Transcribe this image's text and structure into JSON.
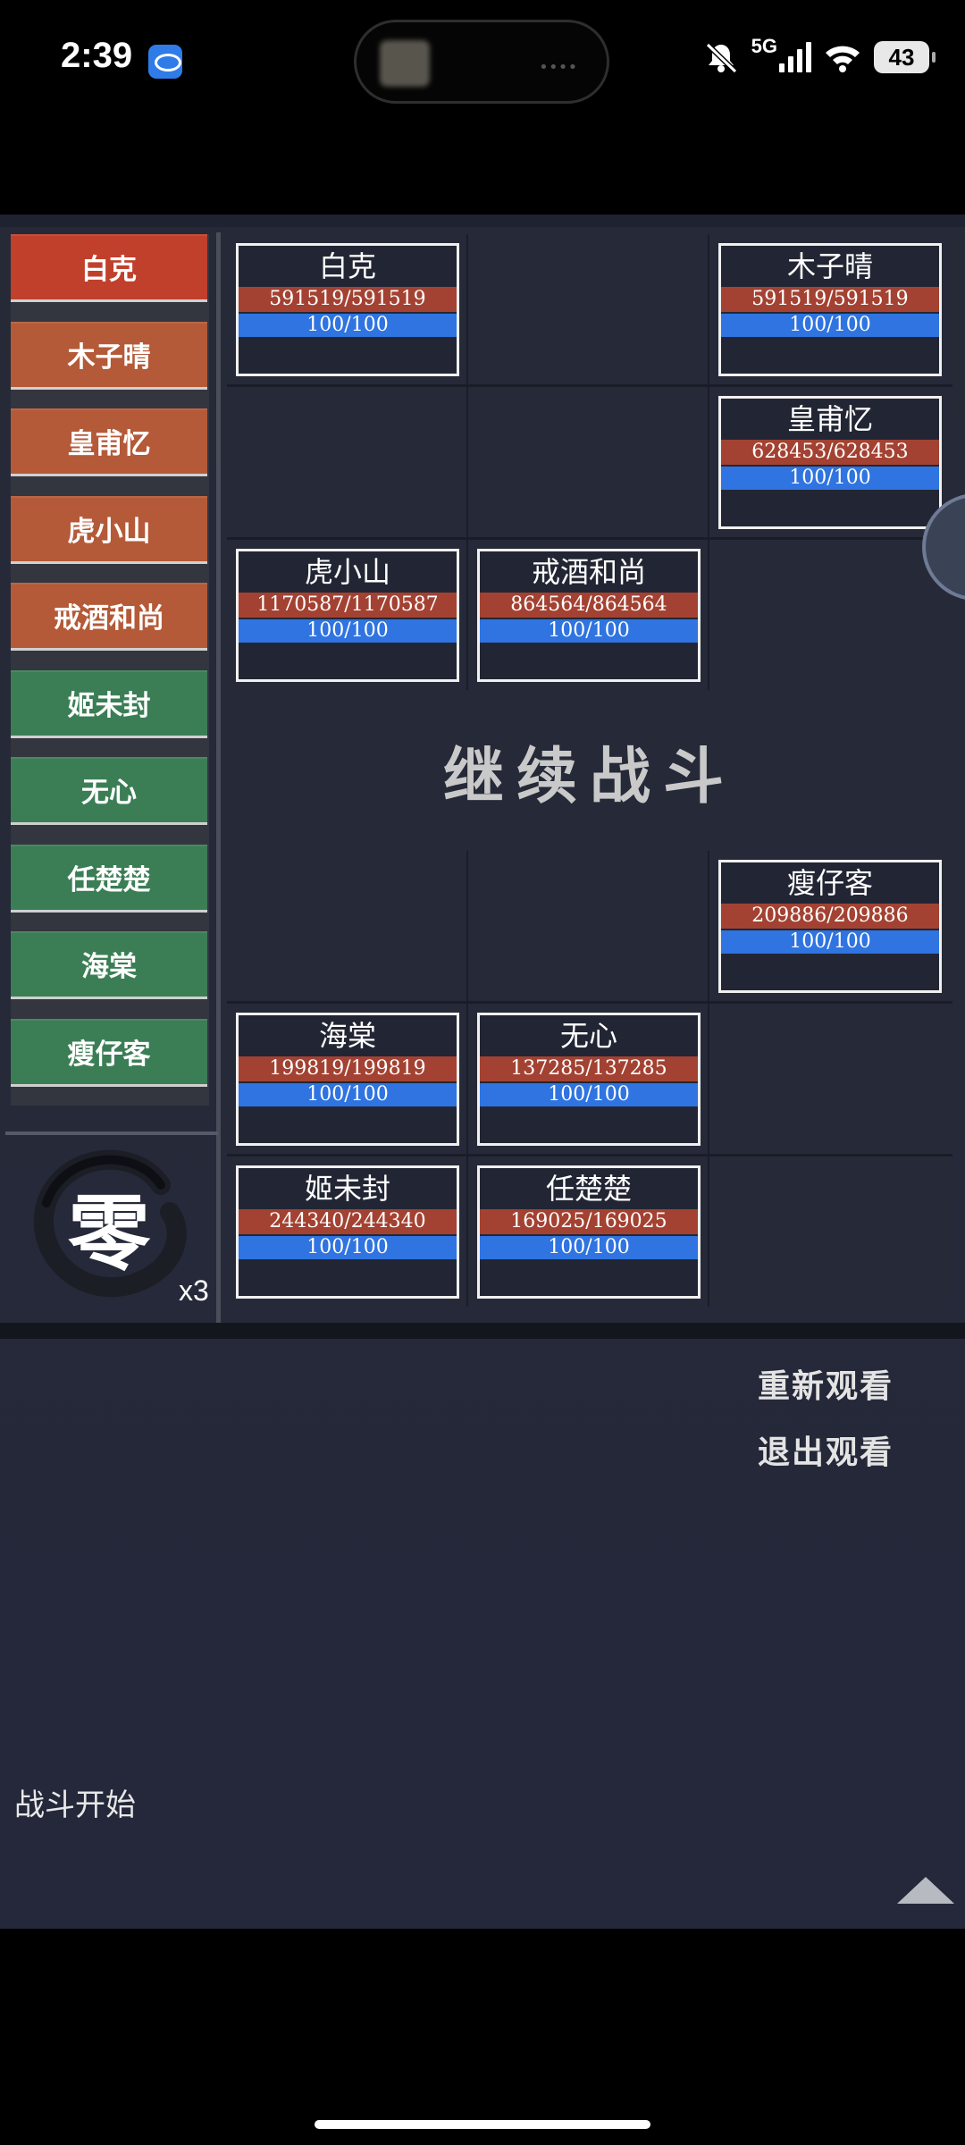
{
  "status_bar": {
    "time": "2:39",
    "network": "5G",
    "battery": "43"
  },
  "roster": [
    {
      "name": "白克",
      "color": "#c0402c"
    },
    {
      "name": "木子晴",
      "color": "#b45a38"
    },
    {
      "name": "皇甫忆",
      "color": "#b45a38"
    },
    {
      "name": "虎小山",
      "color": "#b45a38"
    },
    {
      "name": "戒酒和尚",
      "color": "#b45a38"
    },
    {
      "name": "姬未封",
      "color": "#3b7e55"
    },
    {
      "name": "无心",
      "color": "#3b7e55"
    },
    {
      "name": "任楚楚",
      "color": "#3b7e55"
    },
    {
      "name": "海棠",
      "color": "#3b7e55"
    },
    {
      "name": "瘦仔客",
      "color": "#3b7e55"
    }
  ],
  "emblem": {
    "character": "零",
    "speed": "x3"
  },
  "top_grid": {
    "cards": [
      {
        "row": 0,
        "col": 0,
        "name": "白克",
        "hp": "591519/591519",
        "mp": "100/100"
      },
      {
        "row": 0,
        "col": 2,
        "name": "木子晴",
        "hp": "591519/591519",
        "mp": "100/100"
      },
      {
        "row": 1,
        "col": 2,
        "name": "皇甫忆",
        "hp": "628453/628453",
        "mp": "100/100"
      },
      {
        "row": 2,
        "col": 0,
        "name": "虎小山",
        "hp": "1170587/1170587",
        "mp": "100/100"
      },
      {
        "row": 2,
        "col": 1,
        "name": "戒酒和尚",
        "hp": "864564/864564",
        "mp": "100/100"
      }
    ]
  },
  "continue_label": "继续战斗",
  "bottom_grid": {
    "cards": [
      {
        "row": 0,
        "col": 2,
        "name": "瘦仔客",
        "hp": "209886/209886",
        "mp": "100/100"
      },
      {
        "row": 1,
        "col": 0,
        "name": "海棠",
        "hp": "199819/199819",
        "mp": "100/100"
      },
      {
        "row": 1,
        "col": 1,
        "name": "无心",
        "hp": "137285/137285",
        "mp": "100/100"
      },
      {
        "row": 2,
        "col": 0,
        "name": "姬未封",
        "hp": "244340/244340",
        "mp": "100/100"
      },
      {
        "row": 2,
        "col": 1,
        "name": "任楚楚",
        "hp": "169025/169025",
        "mp": "100/100"
      }
    ]
  },
  "actions": {
    "replay": "重新观看",
    "exit": "退出观看"
  },
  "battle_log": "战斗开始"
}
